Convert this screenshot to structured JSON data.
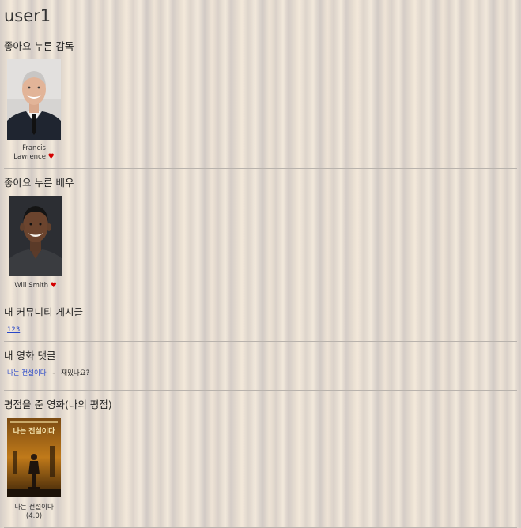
{
  "user": {
    "name": "user1"
  },
  "directors": {
    "title": "좋아요 누른 감독",
    "items": [
      {
        "name_line1": "Francis",
        "name_line2": "Lawrence",
        "heart": "♥"
      }
    ]
  },
  "actors": {
    "title": "좋아요 누른 배우",
    "items": [
      {
        "name": "Will Smith",
        "heart": "♥"
      }
    ]
  },
  "posts": {
    "title": "내 커뮤니티 게시글",
    "items": [
      {
        "label": "123"
      }
    ]
  },
  "comments": {
    "title": "내 영화 댓글",
    "items": [
      {
        "movie": "나는 전설이다",
        "separator": " - ",
        "text": "재밌나요?"
      }
    ]
  },
  "ratings": {
    "title": "평점을 준 영화(나의 평점)",
    "items": [
      {
        "title": "나는 전설이다",
        "score": "(4.0)",
        "poster_text": "나는 전설이다"
      }
    ]
  }
}
